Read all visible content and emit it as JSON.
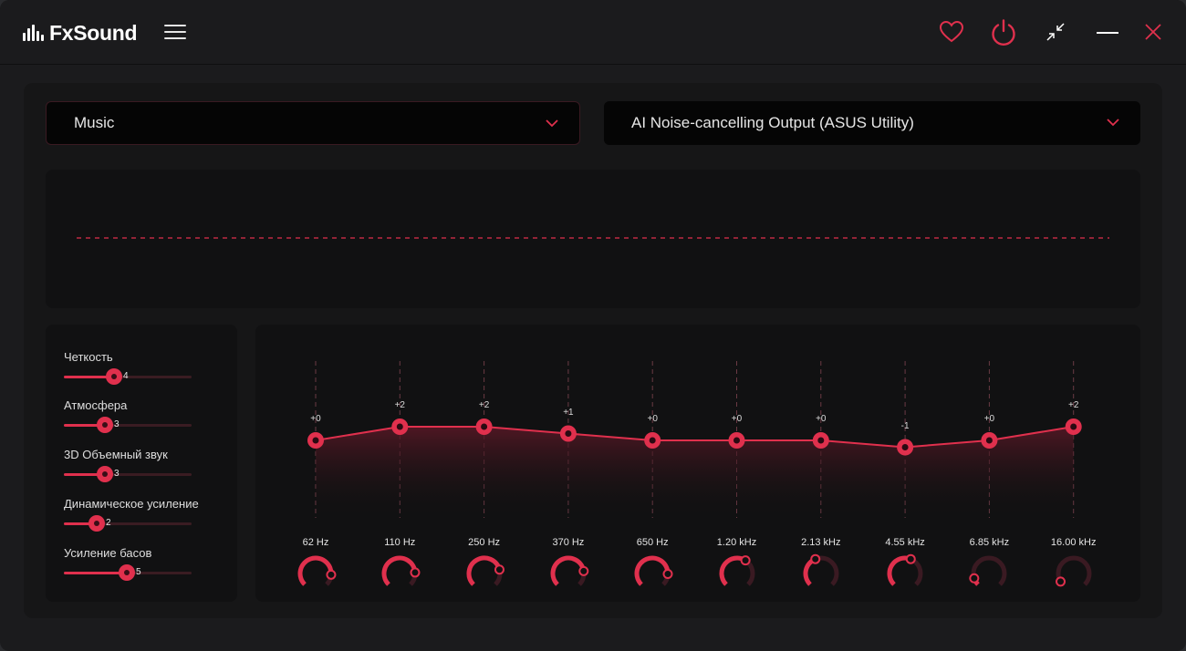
{
  "app": {
    "name": "FxSound"
  },
  "colors": {
    "accent": "#e0304d",
    "background": "#1b1b1d",
    "panel": "#111112"
  },
  "titlebar": {
    "icons": [
      "menu-icon",
      "heart-icon",
      "power-icon",
      "minimize-mode-icon",
      "minimize-icon",
      "close-icon"
    ]
  },
  "preset": {
    "selected": "Music"
  },
  "output": {
    "selected": "AI Noise-cancelling Output (ASUS Utility)"
  },
  "effects": [
    {
      "label": "Четкость",
      "value": "4",
      "level": 4
    },
    {
      "label": "Атмосфера",
      "value": "3",
      "level": 3
    },
    {
      "label": "3D Объемный звук",
      "value": "3",
      "level": 3
    },
    {
      "label": "Динамическое усиление",
      "value": "2",
      "level": 2
    },
    {
      "label": "Усиление басов",
      "value": "5",
      "level": 5
    }
  ],
  "equalizer": {
    "bands": [
      {
        "freq": "62 Hz",
        "gain": "+0",
        "gain_value": 0
      },
      {
        "freq": "110 Hz",
        "gain": "+2",
        "gain_value": 2
      },
      {
        "freq": "250 Hz",
        "gain": "+2",
        "gain_value": 2
      },
      {
        "freq": "370 Hz",
        "gain": "+1",
        "gain_value": 1
      },
      {
        "freq": "650 Hz",
        "gain": "+0",
        "gain_value": 0
      },
      {
        "freq": "1.20 kHz",
        "gain": "+0",
        "gain_value": 0
      },
      {
        "freq": "2.13 kHz",
        "gain": "+0",
        "gain_value": 0
      },
      {
        "freq": "4.55 kHz",
        "gain": "-1",
        "gain_value": -1
      },
      {
        "freq": "6.85 kHz",
        "gain": "+0",
        "gain_value": 0
      },
      {
        "freq": "16.00 kHz",
        "gain": "+2",
        "gain_value": 2
      }
    ],
    "knob_fraction": [
      0.85,
      0.82,
      0.78,
      0.8,
      0.84,
      0.62,
      0.42,
      0.58,
      0.1,
      0.05
    ]
  }
}
